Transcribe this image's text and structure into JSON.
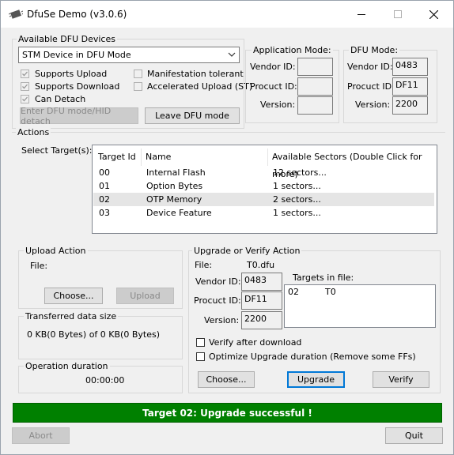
{
  "window": {
    "title": "DfuSe Demo (v3.0.6)"
  },
  "dfu_devices": {
    "group_label": "Available DFU Devices",
    "selected_device": "STM Device in DFU Mode",
    "supports_upload": "Supports Upload",
    "supports_download": "Supports Download",
    "can_detach": "Can Detach",
    "manifestation_tolerant": "Manifestation tolerant",
    "accelerated_upload": "Accelerated Upload (ST)",
    "enter_dfu_button": "Enter DFU mode/HID detach",
    "leave_dfu_button": "Leave DFU mode"
  },
  "application_mode": {
    "group_label": "Application Mode:",
    "vendor_id_label": "Vendor ID:",
    "product_id_label": "Procuct ID:",
    "version_label": "Version:",
    "vendor_id": "",
    "product_id": "",
    "version": ""
  },
  "dfu_mode": {
    "group_label": "DFU Mode:",
    "vendor_id_label": "Vendor ID:",
    "product_id_label": "Procuct ID:",
    "version_label": "Version:",
    "vendor_id": "0483",
    "product_id": "DF11",
    "version": "2200"
  },
  "actions": {
    "group_label": "Actions",
    "select_targets_label": "Select Target(s):",
    "columns": [
      "Target Id",
      "Name",
      "Available Sectors (Double Click for more)"
    ],
    "targets": [
      {
        "id": "00",
        "name": "Internal Flash",
        "sectors": "12 sectors..."
      },
      {
        "id": "01",
        "name": "Option Bytes",
        "sectors": "1 sectors..."
      },
      {
        "id": "02",
        "name": "OTP Memory",
        "sectors": "2 sectors..."
      },
      {
        "id": "03",
        "name": "Device Feature",
        "sectors": "1 sectors..."
      }
    ]
  },
  "upload_action": {
    "group_label": "Upload Action",
    "file_label": "File:",
    "choose_button": "Choose...",
    "upload_button": "Upload"
  },
  "transferred": {
    "group_label": "Transferred data size",
    "value": "0 KB(0 Bytes) of 0 KB(0 Bytes)"
  },
  "operation_duration": {
    "group_label": "Operation duration",
    "value": "00:00:00"
  },
  "upgrade_verify": {
    "group_label": "Upgrade or Verify Action",
    "file_label": "File:",
    "file_name": "T0.dfu",
    "vendor_id_label": "Vendor ID:",
    "product_id_label": "Procuct ID:",
    "version_label": "Version:",
    "vendor_id": "0483",
    "product_id": "DF11",
    "version": "2200",
    "targets_in_file_label": "Targets in file:",
    "targets_in_file": [
      {
        "id": "02",
        "name": "T0"
      }
    ],
    "verify_after_download": "Verify after download",
    "optimize_upgrade": "Optimize Upgrade duration (Remove some FFs)",
    "choose_button": "Choose...",
    "upgrade_button": "Upgrade",
    "verify_button": "Verify"
  },
  "status_message": "Target 02: Upgrade successful !",
  "bottom": {
    "abort_button": "Abort",
    "quit_button": "Quit"
  },
  "colors": {
    "status_bg": "#008000",
    "focus": "#0078d7"
  }
}
